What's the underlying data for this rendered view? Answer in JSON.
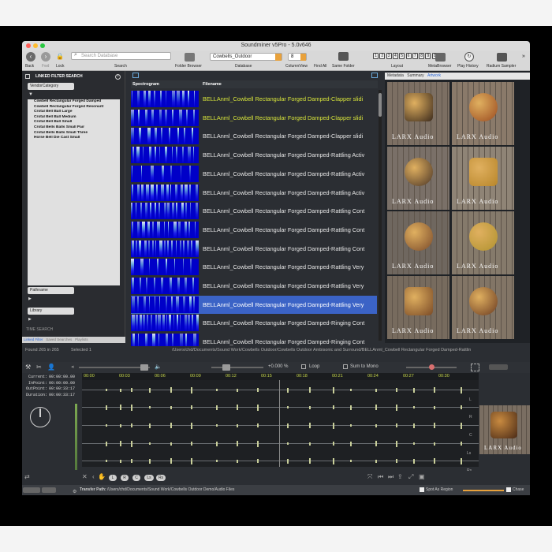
{
  "window": {
    "title": "Soundminer v5Pro - 5.0v646"
  },
  "toolbar": {
    "back": "Back",
    "fwd": "Fwd",
    "lock": "Lock",
    "search_placeholder": "Search Database",
    "search_label": "Search",
    "folder_browser": "Folder Browser",
    "database_value": "Cowbells_Outdoor",
    "database_label": "Database",
    "columnview_value": "8",
    "columnview_label": "ColumnView",
    "find_all": "Find All",
    "same_folder": "Same Folder",
    "layout_label": "Layout",
    "layout_numbers": [
      "1",
      "2",
      "3",
      "4",
      "5",
      "6",
      "7",
      "8",
      "9",
      "0"
    ],
    "metabrowser": "MetaBrowser",
    "play_history": "Play History",
    "radium": "Radium Sampler"
  },
  "linked_filter": {
    "title": "LINKED FILTER SEARCH",
    "category_select": "VendorCategory",
    "items": [
      "Cowbell Rectangular Forged Damped",
      "Cowbell Rectangular Forged Resonant",
      "Crotal Bell Ball Large",
      "Crotal Bell Ball Medium",
      "Crotal Bell Ball Small",
      "Crotal Bells Balls Small Pair",
      "Crotal Bells Balls Small Three",
      "Horse Bell Die Cast Small"
    ],
    "pathname_select": "Pathname",
    "library_select": "Library",
    "time_search": "TIME SEARCH",
    "tabs": [
      "Linked Filter",
      "Saved Searches",
      "Playlists"
    ]
  },
  "results": {
    "columns": {
      "spectrogram": "Spectrogram",
      "filename": "Filename"
    },
    "rows": [
      {
        "filename": "BELLAnml_Cowbell Rectangular Forged Damped-Clapper slidi",
        "state": "hl"
      },
      {
        "filename": "BELLAnml_Cowbell Rectangular Forged Damped-Clapper slidi",
        "state": "hl"
      },
      {
        "filename": "BELLAnml_Cowbell Rectangular Forged Damped-Clapper slidi",
        "state": ""
      },
      {
        "filename": "BELLAnml_Cowbell Rectangular Forged Damped-Rattling Activ",
        "state": ""
      },
      {
        "filename": "BELLAnml_Cowbell Rectangular Forged Damped-Rattling Activ",
        "state": ""
      },
      {
        "filename": "BELLAnml_Cowbell Rectangular Forged Damped-Rattling Activ",
        "state": ""
      },
      {
        "filename": "BELLAnml_Cowbell Rectangular Forged Damped-Rattling Cont",
        "state": ""
      },
      {
        "filename": "BELLAnml_Cowbell Rectangular Forged Damped-Rattling Cont",
        "state": ""
      },
      {
        "filename": "BELLAnml_Cowbell Rectangular Forged Damped-Rattling Cont",
        "state": ""
      },
      {
        "filename": "BELLAnml_Cowbell Rectangular Forged Damped-Rattling Very",
        "state": ""
      },
      {
        "filename": "BELLAnml_Cowbell Rectangular Forged Damped-Rattling Very",
        "state": ""
      },
      {
        "filename": "BELLAnml_Cowbell Rectangular Forged Damped-Rattling Very",
        "state": "sel"
      },
      {
        "filename": "BELLAnml_Cowbell Rectangular Forged Damped-Ringing Cont",
        "state": ""
      },
      {
        "filename": "BELLAnml_Cowbell Rectangular Forged Damped-Ringing Cont",
        "state": ""
      }
    ]
  },
  "artwork": {
    "tabs": [
      "Metadata",
      "Summary",
      "Artwork"
    ],
    "active_tab": "Artwork",
    "watermark": "LARX Audio"
  },
  "status": {
    "found": "Found 265 in 265",
    "selected": "Selected 1",
    "path": "/Users/chd/Documents/Sound Work/Cowbells Outdoor/Cowbells Outdoor Ambisonic and Surround/BELLAnml_Cowbell Rectangular Forged Damped-Rattlin"
  },
  "transport": {
    "level": "+0.000 %",
    "loop": "Loop",
    "sum_to_mono": "Sum to Mono"
  },
  "timeline": {
    "ticks": [
      "00:00",
      "00:03",
      "00:06",
      "00:09",
      "00:12",
      "00:15",
      "00:18",
      "00:21",
      "00:24",
      "00:27",
      "00:30"
    ],
    "channels": [
      "L",
      "R",
      "C",
      "Ls",
      "Rs"
    ]
  },
  "timecodes": {
    "current_label": "Current:",
    "current": "00:00:00.00",
    "inpoint_label": "InPoint:",
    "inpoint": "00:00:00.00",
    "outpoint_label": "OutPoint:",
    "outpoint": "00:00:33:17",
    "duration_label": "Duration:",
    "duration": "00:00:33:17"
  },
  "bottom_controls": {
    "buttons": [
      "L",
      "R",
      "C",
      "Ls",
      "Rs"
    ]
  },
  "footer": {
    "transfer_label": "Transfer Path:",
    "transfer_path": "/Users/chd/Documents/Sound Work/Cowbells Outdoor Demo/Audio Files",
    "spot_as_region": "Spot As Region",
    "chase": "Chase"
  },
  "colors": {
    "accent": "#2f6ad8",
    "highlight_text": "#d8e53a",
    "ruler_text": "#c8d84a",
    "selection": "#3b63c6"
  }
}
